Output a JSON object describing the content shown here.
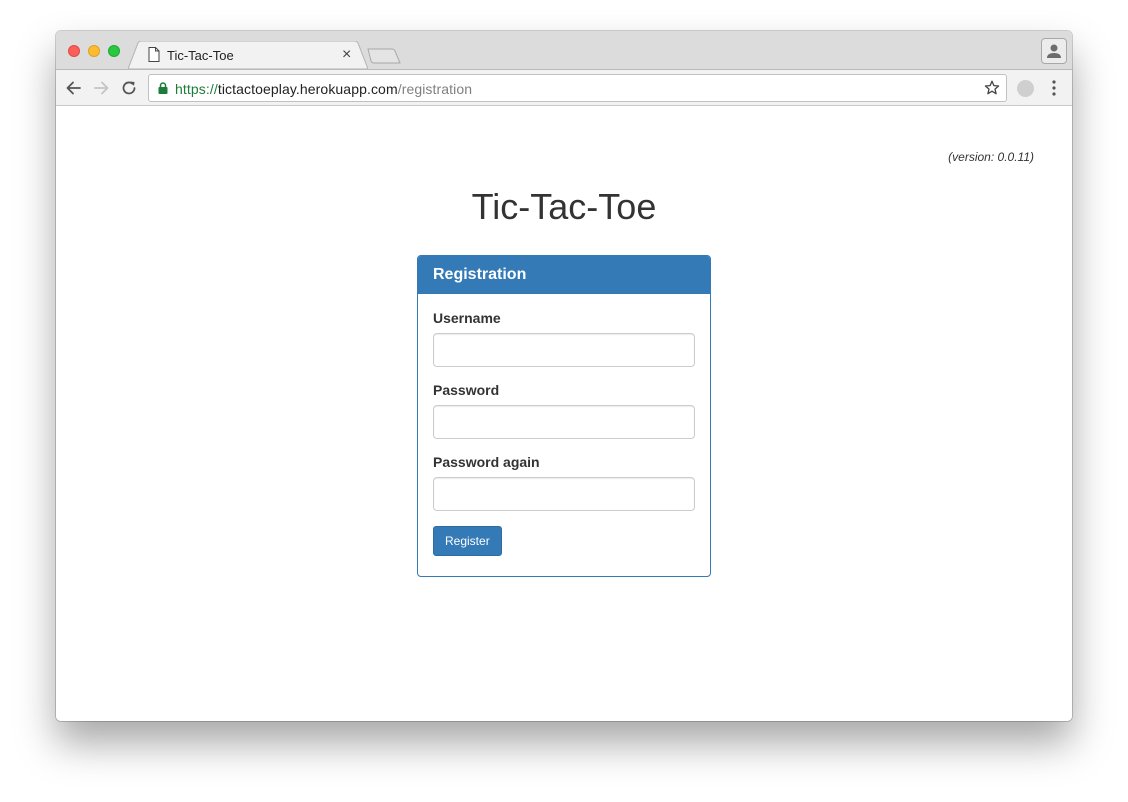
{
  "browser": {
    "tab_title": "Tic-Tac-Toe",
    "tab_close": "×",
    "url_scheme": "https://",
    "url_host": "tictactoeplay.herokuapp.com",
    "url_path": "/registration"
  },
  "page": {
    "version": "(version: 0.0.11)",
    "title": "Tic-Tac-Toe"
  },
  "registration": {
    "heading": "Registration",
    "username_label": "Username",
    "username_value": "",
    "password_label": "Password",
    "password_value": "",
    "password_again_label": "Password again",
    "password_again_value": "",
    "submit_label": "Register"
  },
  "colors": {
    "primary": "#337ab7",
    "secure_scheme": "#1e7c3a",
    "text": "#333333"
  }
}
